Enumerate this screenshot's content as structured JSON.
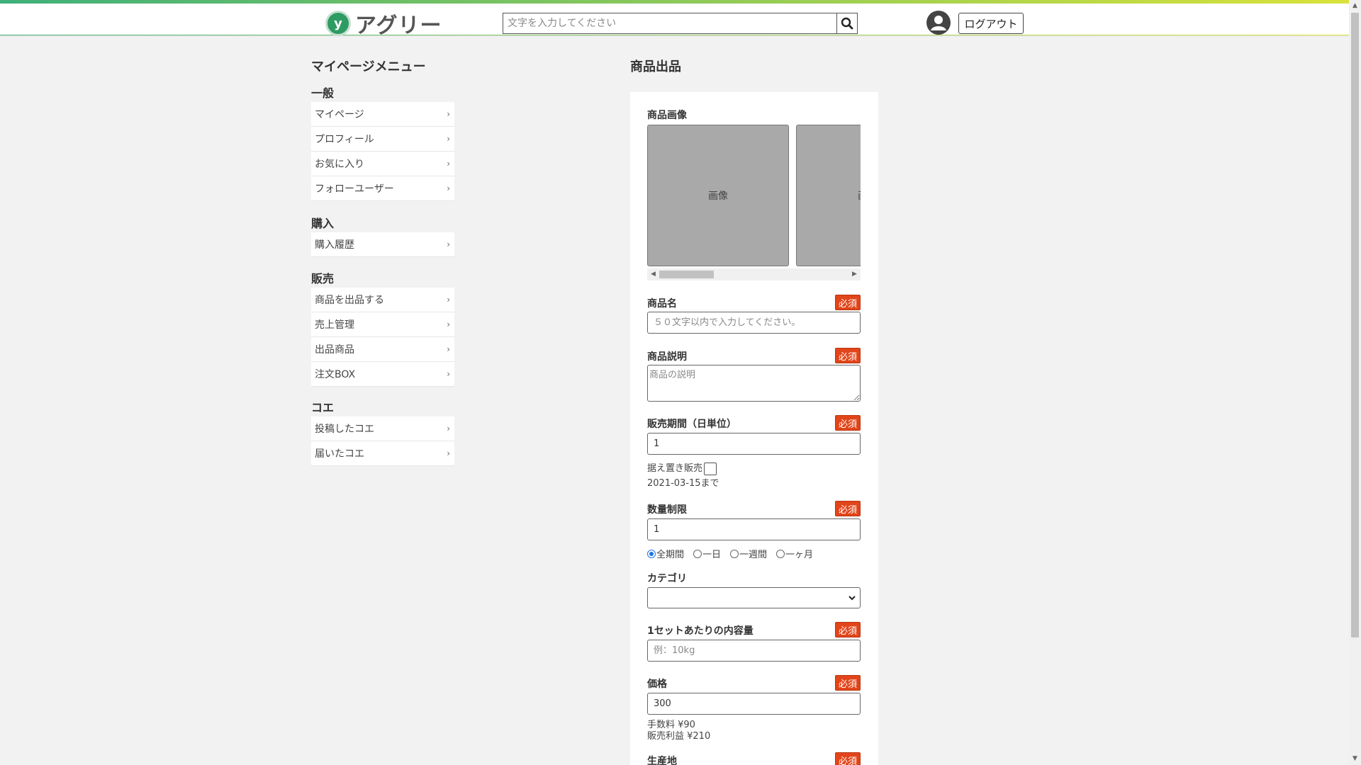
{
  "header": {
    "logo_text": "アグリー",
    "logo_mark": "y",
    "search_placeholder": "文字を入力してください",
    "logout_label": "ログアウト",
    "icons": {
      "search": "search-icon",
      "user": "user-avatar-icon"
    }
  },
  "sidebar": {
    "title": "マイページメニュー",
    "sections": [
      {
        "heading": "一般",
        "items": [
          "マイページ",
          "プロフィール",
          "お気に入り",
          "フォローユーザー"
        ]
      },
      {
        "heading": "購入",
        "items": [
          "購入履歴"
        ]
      },
      {
        "heading": "販売",
        "items": [
          "商品を出品する",
          "売上管理",
          "出品商品",
          "注文BOX"
        ]
      },
      {
        "heading": "コエ",
        "items": [
          "投稿したコエ",
          "届いたコエ"
        ]
      }
    ],
    "chevron": "›"
  },
  "main": {
    "title": "商品出品",
    "required_badge": "必須",
    "product_images": {
      "label": "商品画像",
      "image_placeholder": "画像",
      "image_placeholder_partial": "画"
    },
    "product_name": {
      "label": "商品名",
      "placeholder": "５０文字以内で入力してください。"
    },
    "description": {
      "label": "商品説明",
      "placeholder": "商品の説明"
    },
    "sale_period": {
      "label": "販売期間（日単位）",
      "value": "1",
      "hold_label": "据え置き販売",
      "until_text": "2021-03-15まで"
    },
    "quantity_limit": {
      "label": "数量制限",
      "value": "1",
      "options": [
        "全期間",
        "一日",
        "一週間",
        "一ヶ月"
      ],
      "selected": 0
    },
    "category": {
      "label": "カテゴリ",
      "value": ""
    },
    "content_per_set": {
      "label": "1セットあたりの内容量",
      "placeholder": "例：10kg"
    },
    "price": {
      "label": "価格",
      "value": "300",
      "fee_text": "手数料 ¥90",
      "profit_text": "販売利益 ¥210"
    },
    "origin": {
      "label": "生産地"
    }
  },
  "colors": {
    "accent_green": "#2e9b63",
    "required_red": "#e2451a",
    "page_bg": "#f2f2f2"
  }
}
